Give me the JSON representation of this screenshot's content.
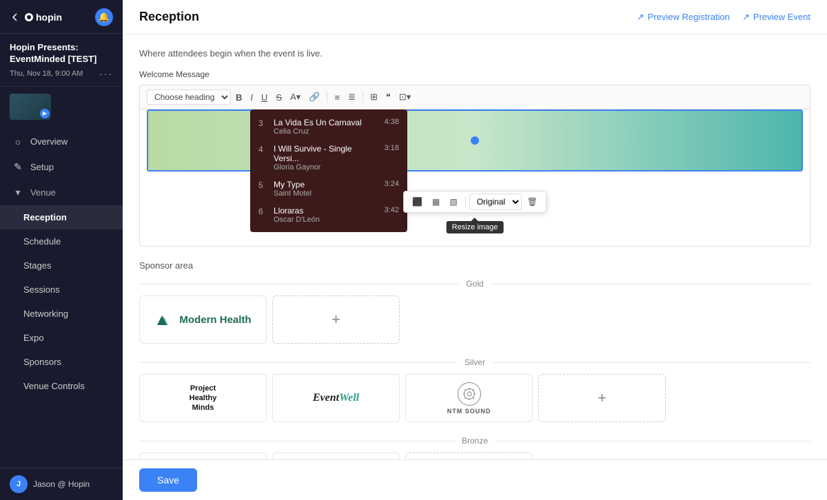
{
  "app": {
    "name": "hopin",
    "logo_text": "hopin"
  },
  "event": {
    "title_line1": "Hopin Presents:",
    "title_line2": "EventMinded [TEST]",
    "date": "Thu, Nov 18, 9:00 AM"
  },
  "nav": {
    "items": [
      {
        "id": "overview",
        "label": "Overview",
        "icon": "○"
      },
      {
        "id": "setup",
        "label": "Setup",
        "icon": "✎"
      },
      {
        "id": "venue",
        "label": "Venue",
        "icon": "▾",
        "is_section": true
      },
      {
        "id": "reception",
        "label": "Reception",
        "active": true
      },
      {
        "id": "schedule",
        "label": "Schedule"
      },
      {
        "id": "stages",
        "label": "Stages"
      },
      {
        "id": "sessions",
        "label": "Sessions"
      },
      {
        "id": "networking",
        "label": "Networking"
      },
      {
        "id": "expo",
        "label": "Expo"
      },
      {
        "id": "sponsors",
        "label": "Sponsors"
      },
      {
        "id": "venue_controls",
        "label": "Venue Controls"
      }
    ]
  },
  "user": {
    "name": "Jason @ Hopin",
    "initials": "J"
  },
  "header": {
    "title": "Reception",
    "preview_registration": "Preview Registration",
    "preview_event": "Preview Event"
  },
  "description": "Where attendees begin when the event is live.",
  "welcome_message_label": "Welcome Message",
  "toolbar": {
    "heading_placeholder": "Choose heading",
    "buttons": [
      "B",
      "I",
      "U",
      "S",
      "A▾",
      "🔗",
      "≡",
      "≣",
      "⊞",
      "❝",
      "⊡▾"
    ]
  },
  "playlist": {
    "items": [
      {
        "num": "3",
        "track": "La Vida Es Un Carnaval",
        "artist": "Celia Cruz",
        "duration": "4:38"
      },
      {
        "num": "4",
        "track": "I Will Survive - Single Versi...",
        "artist": "Gloria Gaynor",
        "duration": "3:18"
      },
      {
        "num": "5",
        "track": "My Type",
        "artist": "Saint Motel",
        "duration": "3:24"
      },
      {
        "num": "6",
        "track": "Lloraras",
        "artist": "Oscar D'León",
        "duration": "3:42"
      }
    ]
  },
  "image_toolbar": {
    "size_option": "Original",
    "resize_tooltip": "Resize image"
  },
  "sponsors": {
    "section_label": "Sponsor area",
    "tiers": [
      {
        "name": "Gold",
        "sponsors": [
          {
            "id": "modern-health",
            "type": "modern-health"
          }
        ]
      },
      {
        "name": "Silver",
        "sponsors": [
          {
            "id": "phm",
            "type": "project-healthy-minds"
          },
          {
            "id": "eventwell",
            "type": "eventwell"
          },
          {
            "id": "ntmsound",
            "type": "ntm-sound"
          }
        ]
      },
      {
        "name": "Bronze",
        "sponsors": [
          {
            "id": "reach",
            "type": "reach"
          },
          {
            "id": "betterhelp",
            "type": "betterhelp"
          }
        ]
      }
    ]
  },
  "save_button": "Save"
}
